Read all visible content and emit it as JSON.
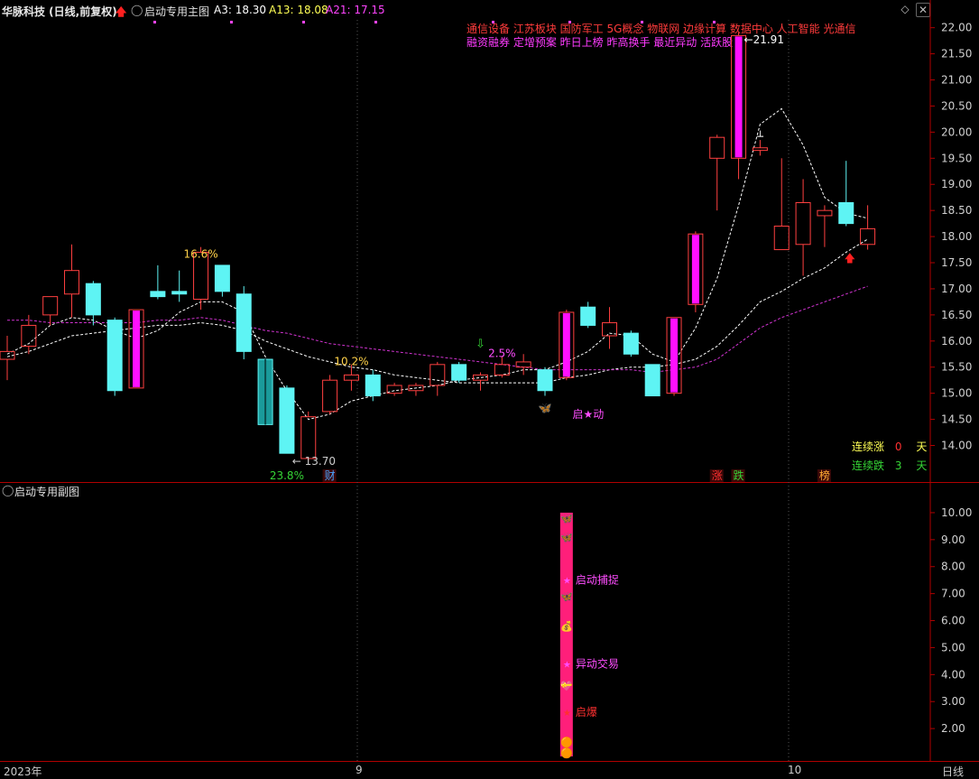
{
  "header": {
    "stock_title": "华脉科技 (日线,前复权)",
    "indicator_name": "启动专用主图",
    "a3_label": "A3: 18.30",
    "a13_label": "A13: 18.08",
    "a21_label": "A21: 17.15"
  },
  "sub_panel": {
    "title": "启动专用副图"
  },
  "concept_tags": [
    [
      "通信设备",
      "江苏板块",
      "国防军工",
      "5G概念",
      "物联网",
      "边缘计算",
      "数据中心",
      "人工智能",
      "光通信"
    ],
    [
      "融资融券",
      "定增预案",
      "昨日上榜",
      "昨高换手",
      "最近异动",
      "活跃股"
    ]
  ],
  "streaks": [
    {
      "label": "连续涨",
      "count": "0",
      "unit": "天"
    },
    {
      "label": "连续跌",
      "count": "3",
      "unit": "天"
    }
  ],
  "bottom_bar": {
    "year_label": "2023年",
    "month9": "9",
    "month10": "10",
    "period_button": "日线"
  },
  "chart_data": [
    {
      "type": "candlestick",
      "title": "",
      "ylim": [
        13.3,
        22.15
      ],
      "y_ticks": [
        14.0,
        14.5,
        15.0,
        15.5,
        16.0,
        16.5,
        17.0,
        17.5,
        18.0,
        18.5,
        19.0,
        19.5,
        20.0,
        20.5,
        21.0,
        21.5,
        22.0
      ],
      "y_tick_labels": [
        "14.00",
        "14.50",
        "15.00",
        "15.50",
        "16.00",
        "16.50",
        "17.00",
        "17.50",
        "18.00",
        "18.50",
        "19.00",
        "19.50",
        "20.00",
        "20.50",
        "21.00",
        "21.50",
        "22.00"
      ],
      "grid": false,
      "candles": [
        {
          "o": 15.65,
          "h": 16.1,
          "l": 15.25,
          "c": 15.8,
          "color": "red"
        },
        {
          "o": 15.9,
          "h": 16.5,
          "l": 15.75,
          "c": 16.3,
          "color": "red"
        },
        {
          "o": 16.5,
          "h": 16.85,
          "l": 16.3,
          "c": 16.85,
          "color": "red"
        },
        {
          "o": 16.9,
          "h": 17.85,
          "l": 16.45,
          "c": 17.35,
          "color": "red"
        },
        {
          "o": 17.1,
          "h": 17.15,
          "l": 16.3,
          "c": 16.5,
          "color": "cyan"
        },
        {
          "o": 16.4,
          "h": 16.45,
          "l": 14.95,
          "c": 15.05,
          "color": "cyan"
        },
        {
          "o": 15.1,
          "h": 16.6,
          "l": 15.1,
          "c": 16.6,
          "color": "magenta"
        },
        {
          "o": 16.95,
          "h": 17.45,
          "l": 16.8,
          "c": 16.85,
          "color": "cyan"
        },
        {
          "o": 16.95,
          "h": 17.35,
          "l": 16.75,
          "c": 16.9,
          "color": "cyan"
        },
        {
          "o": 16.8,
          "h": 17.8,
          "l": 16.6,
          "c": 17.7,
          "color": "red"
        },
        {
          "o": 17.45,
          "h": 17.45,
          "l": 16.85,
          "c": 16.95,
          "color": "cyan"
        },
        {
          "o": 16.9,
          "h": 17.05,
          "l": 15.65,
          "c": 15.8,
          "color": "cyan"
        },
        {
          "o": 15.65,
          "h": 15.65,
          "l": 14.4,
          "c": 14.4,
          "color": "cyan-hollow"
        },
        {
          "o": 15.1,
          "h": 15.15,
          "l": 13.85,
          "c": 13.85,
          "color": "cyan"
        },
        {
          "o": 13.75,
          "h": 14.65,
          "l": 13.7,
          "c": 14.55,
          "color": "red"
        },
        {
          "o": 14.65,
          "h": 15.35,
          "l": 14.6,
          "c": 15.25,
          "color": "red"
        },
        {
          "o": 15.25,
          "h": 15.55,
          "l": 15.05,
          "c": 15.35,
          "color": "red"
        },
        {
          "o": 15.35,
          "h": 15.45,
          "l": 14.85,
          "c": 14.95,
          "color": "cyan"
        },
        {
          "o": 15.0,
          "h": 15.2,
          "l": 14.95,
          "c": 15.15,
          "color": "red"
        },
        {
          "o": 15.05,
          "h": 15.2,
          "l": 14.95,
          "c": 15.15,
          "color": "red"
        },
        {
          "o": 15.15,
          "h": 15.6,
          "l": 14.95,
          "c": 15.55,
          "color": "red"
        },
        {
          "o": 15.55,
          "h": 15.6,
          "l": 15.2,
          "c": 15.25,
          "color": "cyan"
        },
        {
          "o": 15.25,
          "h": 15.4,
          "l": 15.05,
          "c": 15.35,
          "color": "red"
        },
        {
          "o": 15.35,
          "h": 15.7,
          "l": 15.3,
          "c": 15.55,
          "color": "red"
        },
        {
          "o": 15.5,
          "h": 15.75,
          "l": 15.35,
          "c": 15.6,
          "color": "red"
        },
        {
          "o": 15.45,
          "h": 15.5,
          "l": 14.95,
          "c": 15.05,
          "color": "cyan"
        },
        {
          "o": 15.3,
          "h": 16.6,
          "l": 15.25,
          "c": 16.55,
          "color": "magenta"
        },
        {
          "o": 16.65,
          "h": 16.75,
          "l": 16.25,
          "c": 16.3,
          "color": "cyan"
        },
        {
          "o": 16.1,
          "h": 16.65,
          "l": 15.85,
          "c": 16.35,
          "color": "red"
        },
        {
          "o": 16.15,
          "h": 16.2,
          "l": 15.7,
          "c": 15.75,
          "color": "cyan"
        },
        {
          "o": 15.55,
          "h": 15.55,
          "l": 14.95,
          "c": 14.95,
          "color": "cyan"
        },
        {
          "o": 15.0,
          "h": 16.45,
          "l": 14.95,
          "c": 16.45,
          "color": "magenta"
        },
        {
          "o": 16.7,
          "h": 18.1,
          "l": 16.55,
          "c": 18.05,
          "color": "magenta"
        },
        {
          "o": 19.5,
          "h": 19.95,
          "l": 18.5,
          "c": 19.9,
          "color": "red"
        },
        {
          "o": 19.5,
          "h": 21.91,
          "l": 19.1,
          "c": 21.85,
          "color": "magenta"
        },
        {
          "o": 19.65,
          "h": 19.85,
          "l": 19.55,
          "c": 19.7,
          "color": "red"
        },
        {
          "o": 17.75,
          "h": 19.5,
          "l": 17.75,
          "c": 18.2,
          "color": "red"
        },
        {
          "o": 17.85,
          "h": 19.1,
          "l": 17.25,
          "c": 18.65,
          "color": "red"
        },
        {
          "o": 18.4,
          "h": 18.6,
          "l": 17.8,
          "c": 18.5,
          "color": "red"
        },
        {
          "o": 18.65,
          "h": 19.45,
          "l": 18.2,
          "c": 18.25,
          "color": "cyan"
        },
        {
          "o": 17.85,
          "h": 18.6,
          "l": 17.75,
          "c": 18.15,
          "color": "red"
        }
      ],
      "series": [
        {
          "name": "A3",
          "style": "dashed-white",
          "values": [
            15.75,
            15.95,
            16.3,
            16.45,
            16.4,
            16.2,
            16.05,
            16.2,
            16.55,
            16.75,
            16.75,
            16.55,
            15.7,
            15.05,
            14.5,
            14.6,
            14.85,
            14.95,
            15.05,
            15.1,
            15.15,
            15.25,
            15.3,
            15.35,
            15.45,
            15.45,
            15.6,
            15.8,
            16.15,
            16.1,
            15.75,
            15.6,
            16.25,
            17.2,
            18.6,
            20.15,
            20.45,
            19.75,
            18.75,
            18.45,
            18.35
          ]
        },
        {
          "name": "A13",
          "style": "dashed-white",
          "values": [
            15.7,
            15.8,
            15.95,
            16.1,
            16.15,
            16.2,
            16.25,
            16.3,
            16.3,
            16.35,
            16.3,
            16.2,
            16.0,
            15.85,
            15.7,
            15.6,
            15.5,
            15.45,
            15.35,
            15.3,
            15.25,
            15.2,
            15.2,
            15.2,
            15.2,
            15.2,
            15.3,
            15.35,
            15.45,
            15.5,
            15.5,
            15.55,
            15.65,
            15.9,
            16.3,
            16.75,
            16.95,
            17.2,
            17.4,
            17.7,
            17.95
          ]
        },
        {
          "name": "A21",
          "style": "dashed-magenta",
          "values": [
            16.4,
            16.4,
            16.35,
            16.35,
            16.35,
            16.35,
            16.35,
            16.4,
            16.4,
            16.45,
            16.4,
            16.3,
            16.2,
            16.15,
            16.05,
            15.95,
            15.9,
            15.85,
            15.8,
            15.75,
            15.7,
            15.65,
            15.6,
            15.55,
            15.5,
            15.45,
            15.45,
            15.45,
            15.45,
            15.45,
            15.4,
            15.45,
            15.5,
            15.65,
            15.95,
            16.25,
            16.45,
            16.6,
            16.75,
            16.9,
            17.05
          ]
        }
      ],
      "annotations": [
        {
          "text": "16.6%",
          "candle": 9,
          "price": 17.35,
          "color": "#ffd24a"
        },
        {
          "text": "10.2%",
          "candle": 16,
          "price": 15.3,
          "color": "#ffd24a"
        },
        {
          "text": "2.5%",
          "candle": 23,
          "price": 15.45,
          "color": "#ff4dff"
        },
        {
          "text": "21.91",
          "candle": 34,
          "price": 21.91,
          "color": "#fff"
        },
        {
          "text": "13.70",
          "candle": 14,
          "price": 13.7,
          "color": "#ccc"
        },
        {
          "text": "启★动",
          "candle": 26,
          "price": 14.8,
          "color": "#ff4dff"
        },
        {
          "text": "23.8%",
          "candle": 13,
          "price": 13.3,
          "color": "#36d636"
        },
        {
          "text": "财",
          "candle": 15,
          "price": 13.3,
          "color": "#4aa3ff"
        },
        {
          "text": "涨",
          "candle": 33,
          "price": 13.3,
          "color": "#ff3030"
        },
        {
          "text": "跌",
          "candle": 34,
          "price": 13.3,
          "color": "#36d636"
        },
        {
          "text": "榜",
          "candle": 38,
          "price": 13.3,
          "color": "#ffaa33"
        }
      ]
    },
    {
      "type": "bar",
      "title": "",
      "ylim": [
        0.8,
        10.5
      ],
      "y_ticks": [
        2,
        3,
        4,
        5,
        6,
        7,
        8,
        9,
        10
      ],
      "y_tick_labels": [
        "2.00",
        "3.00",
        "4.00",
        "5.00",
        "6.00",
        "7.00",
        "8.00",
        "9.00",
        "10.00"
      ],
      "bars": [
        {
          "candle": 26,
          "value": 10.0,
          "color": "#ff1f7a"
        }
      ],
      "labels": [
        {
          "text": "启动捕捉",
          "value": 7.5,
          "color": "#ff4dff"
        },
        {
          "text": "异动交易",
          "value": 4.4,
          "color": "#ff4dff"
        },
        {
          "text": "启爆",
          "value": 2.6,
          "color": "#ff3030"
        }
      ]
    }
  ]
}
